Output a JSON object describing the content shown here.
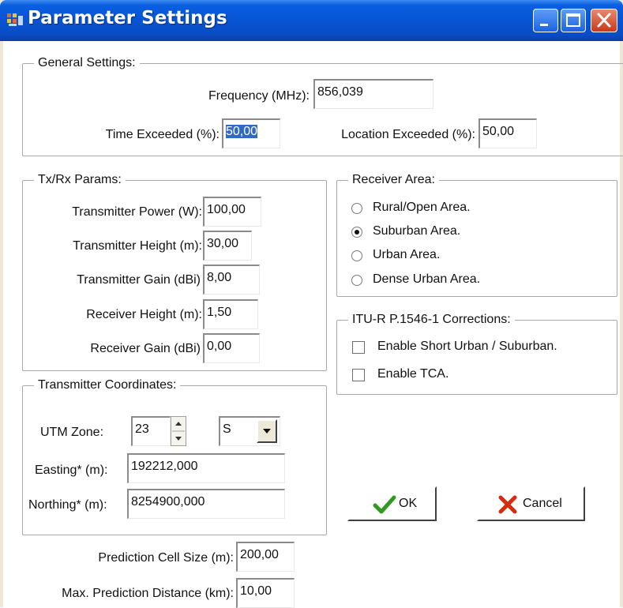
{
  "window": {
    "title": "Parameter Settings",
    "colors": {
      "titlebar": "#0755d6",
      "close_button": "#c9391a",
      "selection": "#316ac5"
    }
  },
  "titlebar_buttons": {
    "minimize_icon": "minimize-icon",
    "maximize_icon": "maximize-icon",
    "close_icon": "close-icon"
  },
  "general": {
    "legend": "General Settings:",
    "frequency_label": "Frequency (MHz):",
    "frequency_value": "856,039",
    "time_label": "Time Exceeded (%):",
    "time_value": "50,00",
    "location_label": "Location Exceeded (%):",
    "location_value": "50,00"
  },
  "txrx": {
    "legend": "Tx/Rx Params:",
    "tx_power_label": "Transmitter Power (W):",
    "tx_power_value": "100,00",
    "tx_height_label": "Transmitter Height (m):",
    "tx_height_value": "30,00",
    "tx_gain_label": "Transmitter Gain (dBi)",
    "tx_gain_value": "8,00",
    "rx_height_label": "Receiver Height (m):",
    "rx_height_value": "1,50",
    "rx_gain_label": "Receiver Gain (dBi)",
    "rx_gain_value": "0,00"
  },
  "receiver_area": {
    "legend": "Receiver Area:",
    "options": [
      "Rural/Open Area.",
      "Suburban Area.",
      "Urban Area.",
      "Dense Urban Area."
    ],
    "selected": "Suburban Area."
  },
  "itu": {
    "legend": "ITU-R P.1546-1 Corrections:",
    "short_urban_label": "Enable Short Urban / Suburban.",
    "short_urban_checked": false,
    "tca_label": "Enable TCA.",
    "tca_checked": false
  },
  "coords": {
    "legend": "Transmitter Coordinates:",
    "utm_zone_label": "UTM Zone:",
    "utm_zone_value": "23",
    "hemisphere_value": "S",
    "easting_label": "Easting* (m):",
    "easting_value": "192212,000",
    "northing_label": "Northing* (m):",
    "northing_value": "8254900,000"
  },
  "prediction": {
    "cell_size_label": "Prediction Cell Size (m):",
    "cell_size_value": "200,00",
    "max_distance_label": "Max. Prediction Distance (km):",
    "max_distance_value": "10,00"
  },
  "buttons": {
    "ok_label": "OK",
    "cancel_label": "Cancel",
    "ok_icon": "checkmark-icon",
    "cancel_icon": "x-icon",
    "ok_icon_color": "#2f9a1f",
    "cancel_icon_color": "#d42d10"
  }
}
